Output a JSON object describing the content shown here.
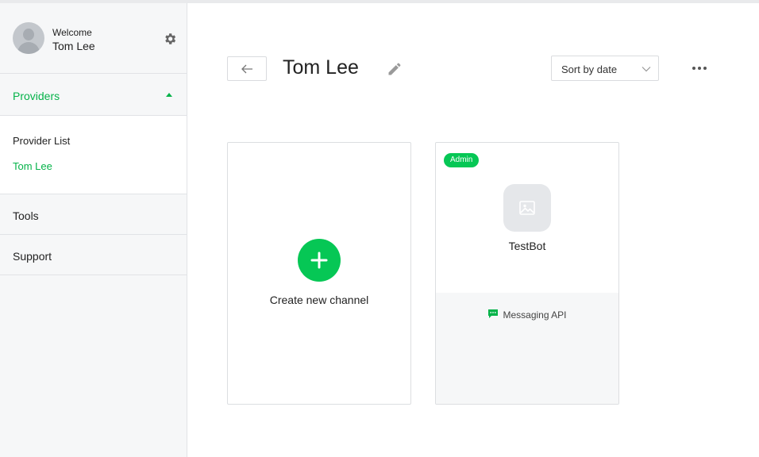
{
  "sidebar": {
    "welcome": "Welcome",
    "username": "Tom Lee",
    "providers_label": "Providers",
    "provider_sub_items": [
      "Provider List",
      "Tom Lee"
    ],
    "tools_label": "Tools",
    "support_label": "Support",
    "colors": {
      "accent": "#06b34a",
      "background": "#f6f7f8"
    }
  },
  "header": {
    "title": "Tom Lee",
    "sort_value": "Sort by date"
  },
  "cards": {
    "create_label": "Create new channel",
    "bot": {
      "badge": "Admin",
      "name": "TestBot",
      "api_label": "Messaging API"
    }
  },
  "icons": {
    "settings": "gear-icon",
    "back": "arrow-left-icon",
    "edit": "pencil-icon",
    "sort_caret": "chevron-down-icon",
    "more": "ellipsis-icon",
    "create": "plus-icon",
    "bot_image": "image-placeholder-icon",
    "api": "chat-bubble-icon"
  },
  "colors": {
    "brand_green": "#06c755",
    "text": "#222222",
    "border": "#dcdee1"
  }
}
